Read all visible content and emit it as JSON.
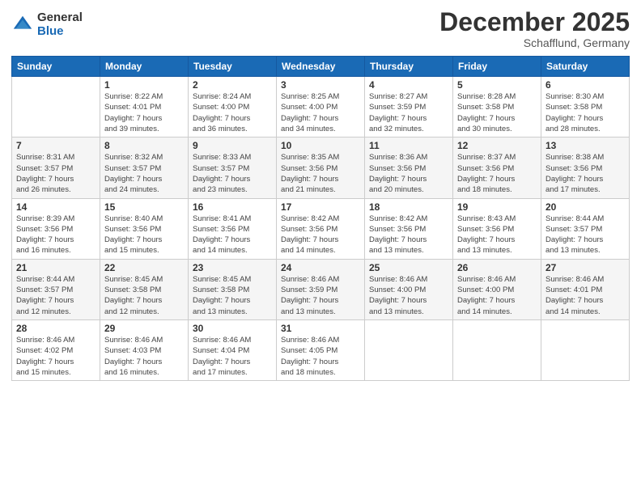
{
  "logo": {
    "general": "General",
    "blue": "Blue"
  },
  "header": {
    "title": "December 2025",
    "subtitle": "Schafflund, Germany"
  },
  "days_of_week": [
    "Sunday",
    "Monday",
    "Tuesday",
    "Wednesday",
    "Thursday",
    "Friday",
    "Saturday"
  ],
  "weeks": [
    [
      {
        "day": "",
        "detail": ""
      },
      {
        "day": "1",
        "detail": "Sunrise: 8:22 AM\nSunset: 4:01 PM\nDaylight: 7 hours\nand 39 minutes."
      },
      {
        "day": "2",
        "detail": "Sunrise: 8:24 AM\nSunset: 4:00 PM\nDaylight: 7 hours\nand 36 minutes."
      },
      {
        "day": "3",
        "detail": "Sunrise: 8:25 AM\nSunset: 4:00 PM\nDaylight: 7 hours\nand 34 minutes."
      },
      {
        "day": "4",
        "detail": "Sunrise: 8:27 AM\nSunset: 3:59 PM\nDaylight: 7 hours\nand 32 minutes."
      },
      {
        "day": "5",
        "detail": "Sunrise: 8:28 AM\nSunset: 3:58 PM\nDaylight: 7 hours\nand 30 minutes."
      },
      {
        "day": "6",
        "detail": "Sunrise: 8:30 AM\nSunset: 3:58 PM\nDaylight: 7 hours\nand 28 minutes."
      }
    ],
    [
      {
        "day": "7",
        "detail": "Sunrise: 8:31 AM\nSunset: 3:57 PM\nDaylight: 7 hours\nand 26 minutes."
      },
      {
        "day": "8",
        "detail": "Sunrise: 8:32 AM\nSunset: 3:57 PM\nDaylight: 7 hours\nand 24 minutes."
      },
      {
        "day": "9",
        "detail": "Sunrise: 8:33 AM\nSunset: 3:57 PM\nDaylight: 7 hours\nand 23 minutes."
      },
      {
        "day": "10",
        "detail": "Sunrise: 8:35 AM\nSunset: 3:56 PM\nDaylight: 7 hours\nand 21 minutes."
      },
      {
        "day": "11",
        "detail": "Sunrise: 8:36 AM\nSunset: 3:56 PM\nDaylight: 7 hours\nand 20 minutes."
      },
      {
        "day": "12",
        "detail": "Sunrise: 8:37 AM\nSunset: 3:56 PM\nDaylight: 7 hours\nand 18 minutes."
      },
      {
        "day": "13",
        "detail": "Sunrise: 8:38 AM\nSunset: 3:56 PM\nDaylight: 7 hours\nand 17 minutes."
      }
    ],
    [
      {
        "day": "14",
        "detail": "Sunrise: 8:39 AM\nSunset: 3:56 PM\nDaylight: 7 hours\nand 16 minutes."
      },
      {
        "day": "15",
        "detail": "Sunrise: 8:40 AM\nSunset: 3:56 PM\nDaylight: 7 hours\nand 15 minutes."
      },
      {
        "day": "16",
        "detail": "Sunrise: 8:41 AM\nSunset: 3:56 PM\nDaylight: 7 hours\nand 14 minutes."
      },
      {
        "day": "17",
        "detail": "Sunrise: 8:42 AM\nSunset: 3:56 PM\nDaylight: 7 hours\nand 14 minutes."
      },
      {
        "day": "18",
        "detail": "Sunrise: 8:42 AM\nSunset: 3:56 PM\nDaylight: 7 hours\nand 13 minutes."
      },
      {
        "day": "19",
        "detail": "Sunrise: 8:43 AM\nSunset: 3:56 PM\nDaylight: 7 hours\nand 13 minutes."
      },
      {
        "day": "20",
        "detail": "Sunrise: 8:44 AM\nSunset: 3:57 PM\nDaylight: 7 hours\nand 13 minutes."
      }
    ],
    [
      {
        "day": "21",
        "detail": "Sunrise: 8:44 AM\nSunset: 3:57 PM\nDaylight: 7 hours\nand 12 minutes."
      },
      {
        "day": "22",
        "detail": "Sunrise: 8:45 AM\nSunset: 3:58 PM\nDaylight: 7 hours\nand 12 minutes."
      },
      {
        "day": "23",
        "detail": "Sunrise: 8:45 AM\nSunset: 3:58 PM\nDaylight: 7 hours\nand 13 minutes."
      },
      {
        "day": "24",
        "detail": "Sunrise: 8:46 AM\nSunset: 3:59 PM\nDaylight: 7 hours\nand 13 minutes."
      },
      {
        "day": "25",
        "detail": "Sunrise: 8:46 AM\nSunset: 4:00 PM\nDaylight: 7 hours\nand 13 minutes."
      },
      {
        "day": "26",
        "detail": "Sunrise: 8:46 AM\nSunset: 4:00 PM\nDaylight: 7 hours\nand 14 minutes."
      },
      {
        "day": "27",
        "detail": "Sunrise: 8:46 AM\nSunset: 4:01 PM\nDaylight: 7 hours\nand 14 minutes."
      }
    ],
    [
      {
        "day": "28",
        "detail": "Sunrise: 8:46 AM\nSunset: 4:02 PM\nDaylight: 7 hours\nand 15 minutes."
      },
      {
        "day": "29",
        "detail": "Sunrise: 8:46 AM\nSunset: 4:03 PM\nDaylight: 7 hours\nand 16 minutes."
      },
      {
        "day": "30",
        "detail": "Sunrise: 8:46 AM\nSunset: 4:04 PM\nDaylight: 7 hours\nand 17 minutes."
      },
      {
        "day": "31",
        "detail": "Sunrise: 8:46 AM\nSunset: 4:05 PM\nDaylight: 7 hours\nand 18 minutes."
      },
      {
        "day": "",
        "detail": ""
      },
      {
        "day": "",
        "detail": ""
      },
      {
        "day": "",
        "detail": ""
      }
    ]
  ]
}
